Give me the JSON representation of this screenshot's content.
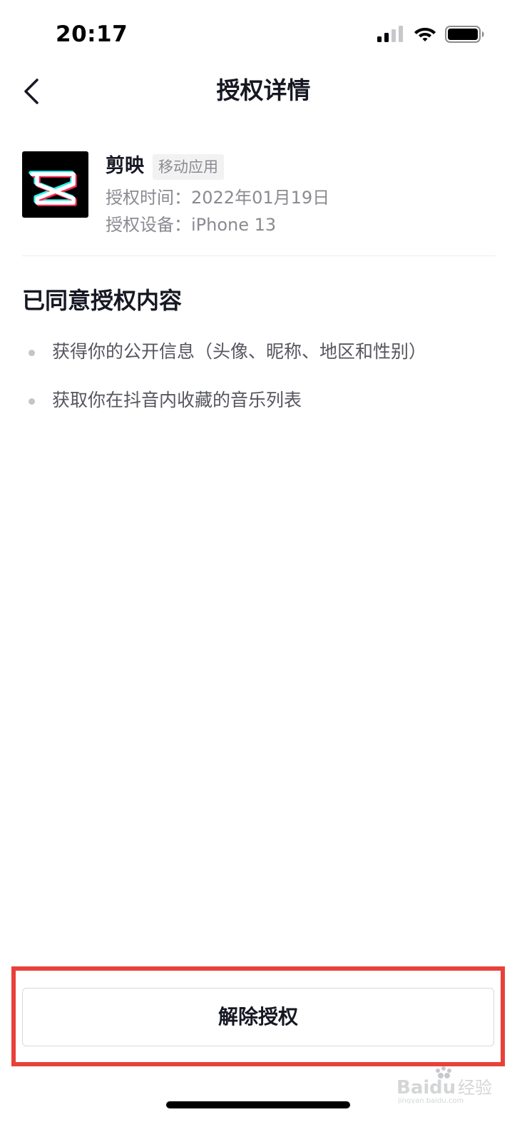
{
  "status_bar": {
    "time": "20:17",
    "signal_icon": "cellular-signal-icon",
    "wifi_icon": "wifi-icon",
    "battery_icon": "battery-icon"
  },
  "nav": {
    "back_icon": "chevron-left-icon",
    "title": "授权详情"
  },
  "app": {
    "name": "剪映",
    "tag": "移动应用",
    "auth_time": "授权时间：2022年01月19日",
    "auth_device": "授权设备：iPhone 13",
    "icon": "capcut-logo-icon"
  },
  "consent": {
    "title": "已同意授权内容",
    "items": [
      "获得你的公开信息（头像、昵称、地区和性别）",
      "获取你在抖音内收藏的音乐列表"
    ]
  },
  "actions": {
    "revoke_label": "解除授权"
  },
  "colors": {
    "highlight": "#e8413a",
    "text_primary": "#161823",
    "text_secondary": "#8a8b91"
  },
  "watermark": {
    "text": "Baidu经验",
    "sub": "jingyan.baidu.com"
  }
}
